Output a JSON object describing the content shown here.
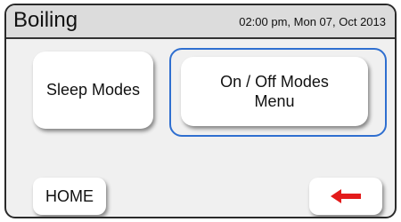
{
  "header": {
    "title": "Boiling",
    "datetime": "02:00 pm, Mon 07, Oct 2013"
  },
  "menu": {
    "sleep_modes_label": "Sleep Modes",
    "onoff_label": "On / Off Modes\nMenu",
    "selected_item": "onoff"
  },
  "footer": {
    "home_label": "HOME",
    "back_icon": "back-arrow-icon"
  },
  "colors": {
    "selection_border": "#2f6fd0",
    "arrow": "#e31b1b",
    "background": "#f0f0f0",
    "header": "#dcdcdc"
  }
}
